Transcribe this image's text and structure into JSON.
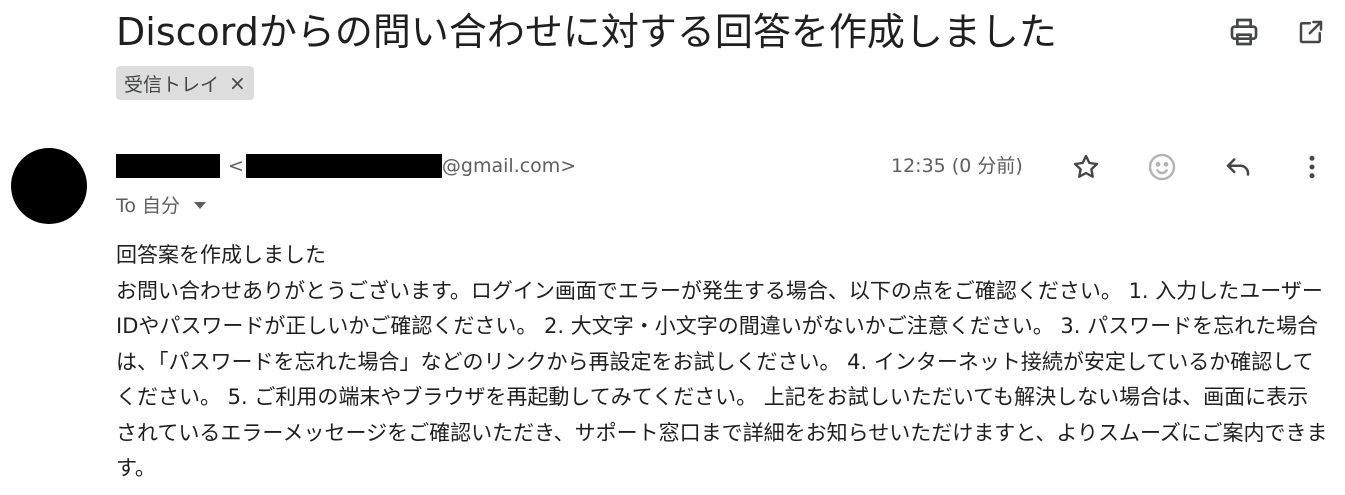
{
  "email": {
    "subject": "Discordからの問い合わせに対する回答を作成しました",
    "label": "受信トレイ",
    "label_remove": "×",
    "sender_email_suffix": "@gmail.com>",
    "sender_open_bracket": "<",
    "time": "12:35 (0 分前)",
    "to": "To 自分",
    "body_first_line": "回答案を作成しました",
    "body_paragraph": "お問い合わせありがとうございます。ログイン画面でエラーが発生する場合、以下の点をご確認ください。 1. 入力したユーザーIDやパスワードが正しいかご確認ください。 2. 大文字・小文字の間違いがないかご注意ください。 3. パスワードを忘れた場合は、「パスワードを忘れた場合」などのリンクから再設定をお試しください。 4. インターネット接続が安定しているか確認してください。 5. ご利用の端末やブラウザを再起動してみてください。 上記をお試しいただいても解決しない場合は、画面に表示されているエラーメッセージをご確認いただき、サポート窓口まで詳細をお知らせいただけますと、よりスムーズにご案内できます。"
  },
  "icons": {
    "print": "print-icon",
    "open_new_window": "open-in-new-window-icon",
    "star": "star-icon",
    "emoji": "emoji-reaction-icon",
    "reply": "reply-icon",
    "more": "more-vertical-icon",
    "color": "#444746"
  }
}
